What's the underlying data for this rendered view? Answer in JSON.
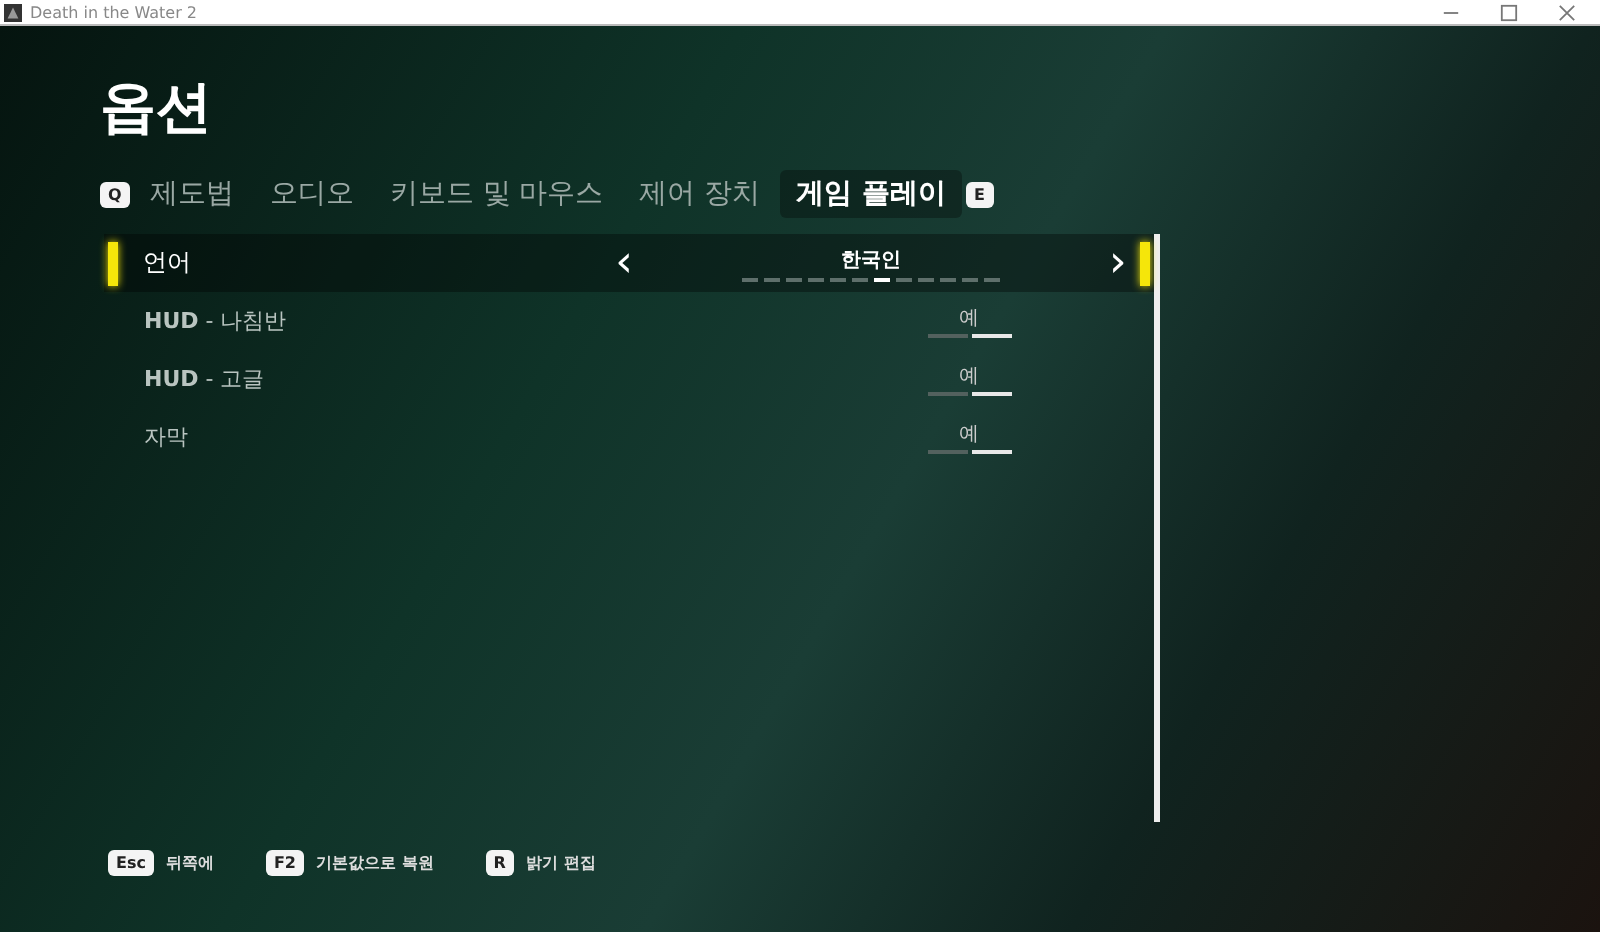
{
  "window": {
    "title": "Death in the Water 2"
  },
  "heading": "옵션",
  "tab_prev_key": "Q",
  "tab_next_key": "E",
  "tabs": [
    {
      "label": "제도법",
      "selected": false
    },
    {
      "label": "오디오",
      "selected": false
    },
    {
      "label": "키보드 및 마우스",
      "selected": false
    },
    {
      "label": "제어 장치",
      "selected": false
    },
    {
      "label": "게임 플레이",
      "selected": true
    }
  ],
  "settings": [
    {
      "kind": "selector",
      "label": "언어",
      "value": "한국인",
      "selected": true,
      "prev": "‹",
      "next": "›",
      "pages": [
        {
          "selected": false
        },
        {
          "selected": false
        },
        {
          "selected": false
        },
        {
          "selected": false
        },
        {
          "selected": false
        },
        {
          "selected": false
        },
        {
          "selected": true
        },
        {
          "selected": false
        },
        {
          "selected": false
        },
        {
          "selected": false
        },
        {
          "selected": false
        },
        {
          "selected": false
        }
      ]
    },
    {
      "kind": "toggle",
      "label": "**HUD** - 나침반",
      "value": "예",
      "on": true,
      "selected": false
    },
    {
      "kind": "toggle",
      "label": "**HUD** - 고글",
      "value": "예",
      "on": true,
      "selected": false
    },
    {
      "kind": "toggle",
      "label": "자막",
      "value": "예",
      "on": true,
      "selected": false
    }
  ],
  "footer": [
    {
      "key": "Esc",
      "label": "뒤쪽에"
    },
    {
      "key": "F2",
      "label": "기본값으로 복원"
    },
    {
      "key": "R",
      "label": "밝기 편집"
    }
  ]
}
